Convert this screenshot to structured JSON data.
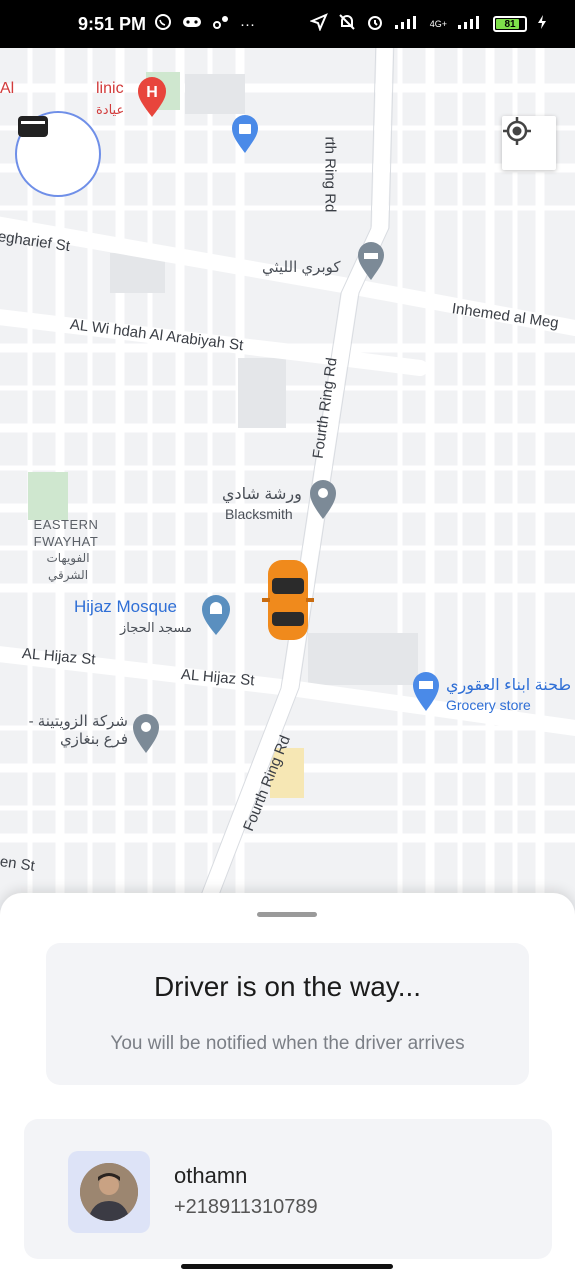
{
  "status_bar": {
    "time": "9:51 PM",
    "left_icons": [
      "whatsapp-icon",
      "game-icon",
      "link-icon",
      "more-icon"
    ],
    "right_icons": [
      "location-arrow-icon",
      "mute-icon",
      "alarm-icon",
      "signal-icon",
      "4g-signal-icon"
    ],
    "network": "4G+",
    "battery": "81",
    "battery_level": 0.81
  },
  "map": {
    "labels": {
      "clinic": "Al",
      "clinic_b": "linic",
      "clinic_ar": "عيادة",
      "street_egharief": "egharief St",
      "bridge_ar": "كوبري الليثي",
      "street_inhemed": "Inhemed al Meg",
      "street_wihdah": "AL Wi hdah Al Arabiyah St",
      "fourth_ring_top": "rth Ring Rd",
      "fourth_ring_mid": "Fourth Ring Rd",
      "fourth_ring_low": "Fourth Ring Rd",
      "blacksmith_ar": "ورشة شادي",
      "blacksmith": "Blacksmith",
      "area_en": "EASTERN FWAYHAT",
      "area_ar": "الفويهات الشرقي",
      "mosque": "Hijaz Mosque",
      "mosque_ar": "مسجد الحجاز",
      "street_hijaz_1": "AL Hijaz St",
      "street_hijaz_2": "AL Hijaz St",
      "grocery_ar": "طحنة ابناء العقوري",
      "grocery": "Grocery store",
      "company_ar": "شركة الزويتينة - فرع بنغازي",
      "street_en": "en St"
    },
    "wallet_button": "wallet-icon",
    "locate_button": "locate-icon",
    "car_color": "#f08a1c"
  },
  "sheet": {
    "title": "Driver is on the way...",
    "subtitle": "You will be notified when the driver arrives",
    "driver": {
      "name": "othamn",
      "phone": "+218911310789"
    }
  },
  "colors": {
    "accent": "#6f8fe8",
    "poi_blue": "#2f6fd6",
    "poi_red": "#e8453c",
    "pin_gray": "#7c8a97"
  }
}
